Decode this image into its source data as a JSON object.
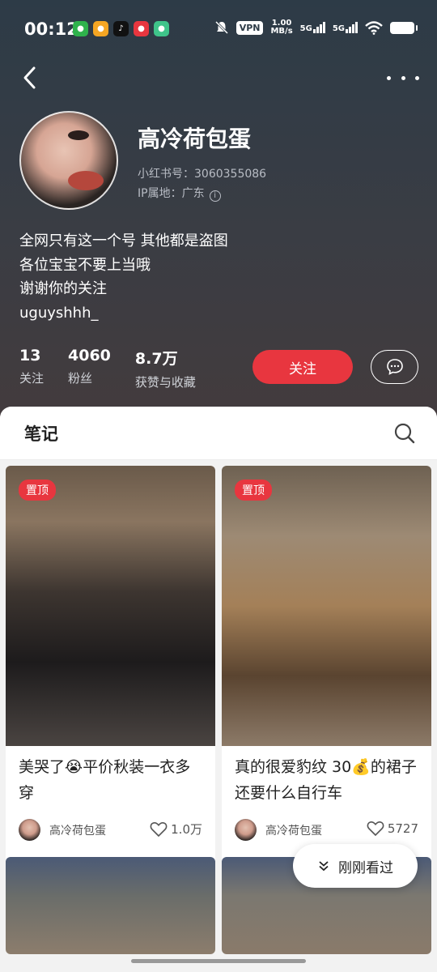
{
  "status_bar": {
    "time": "00:12",
    "vpn": "VPN",
    "speed_value": "1.00",
    "speed_unit": "MB/s",
    "signal1": "5G",
    "signal2": "5G"
  },
  "profile": {
    "name": "高冷荷包蛋",
    "id_line": "小红书号：3060355086",
    "ip_line": "IP属地：广东",
    "bio": [
      "全网只有这一个号 其他都是盗图",
      "各位宝宝不要上当哦",
      "谢谢你的关注",
      "uguyshhh_"
    ],
    "stats": [
      {
        "value": "13",
        "label": "关注"
      },
      {
        "value": "4060",
        "label": "粉丝"
      },
      {
        "value": "8.7万",
        "label": "获赞与收藏"
      }
    ],
    "follow_label": "关注"
  },
  "notes": {
    "title": "笔记",
    "cards": [
      {
        "pin": "置顶",
        "title": "美哭了😭平价秋装一衣多穿",
        "author": "高冷荷包蛋",
        "likes": "1.0万"
      },
      {
        "pin": "置顶",
        "title": "真的很爱豹纹 30💰的裙子还要什么自行车",
        "author": "高冷荷包蛋",
        "likes": "5727"
      }
    ]
  },
  "recent_button": "刚刚看过",
  "colors": {
    "accent": "#e8363f",
    "header_top": "#2d3b47",
    "header_bottom": "#433b3d"
  }
}
